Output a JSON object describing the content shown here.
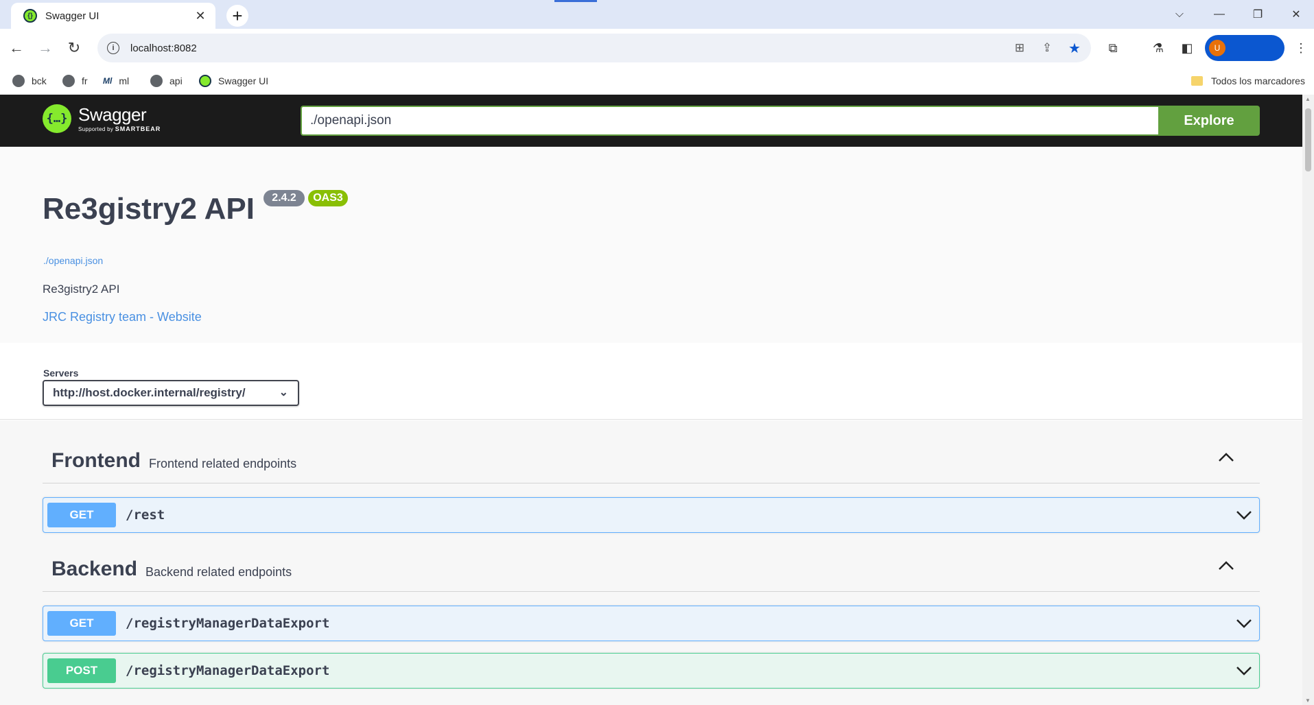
{
  "browser": {
    "tab": {
      "title": "Swagger UI",
      "close": "✕"
    },
    "new_tab": "+",
    "url": "localhost:8082",
    "bookmarks": [
      {
        "label": "bck"
      },
      {
        "label": "fr"
      },
      {
        "label": "ml"
      },
      {
        "label": "api"
      },
      {
        "label": "Swagger UI"
      }
    ],
    "bookmarks_folder": "Todos los marcadores",
    "profile_initial": "U"
  },
  "swagger": {
    "logo_text": "Swagger",
    "logo_sub": "Supported by",
    "logo_sub_brand": "SMARTBEAR",
    "search_value": "./openapi.json",
    "explore_label": "Explore"
  },
  "info": {
    "title": "Re3gistry2 API",
    "version": "2.4.2",
    "oas": "OAS3",
    "spec_url": "./openapi.json",
    "description": "Re3gistry2 API",
    "contact": "JRC Registry team - Website"
  },
  "servers": {
    "label": "Servers",
    "selected": "http://host.docker.internal/registry/"
  },
  "tags": [
    {
      "name": "Frontend",
      "description": "Frontend related endpoints",
      "operations": [
        {
          "method": "GET",
          "path": "/rest"
        }
      ]
    },
    {
      "name": "Backend",
      "description": "Backend related endpoints",
      "operations": [
        {
          "method": "GET",
          "path": "/registryManagerDataExport"
        },
        {
          "method": "POST",
          "path": "/registryManagerDataExport"
        }
      ]
    }
  ],
  "colors": {
    "topbar_bg": "#1b1b1b",
    "explore_green": "#62a03f",
    "get_blue": "#61affe",
    "post_green": "#49cc90",
    "link_blue": "#4990e2",
    "oas_badge": "#89bf04",
    "version_badge": "#7d8492"
  }
}
